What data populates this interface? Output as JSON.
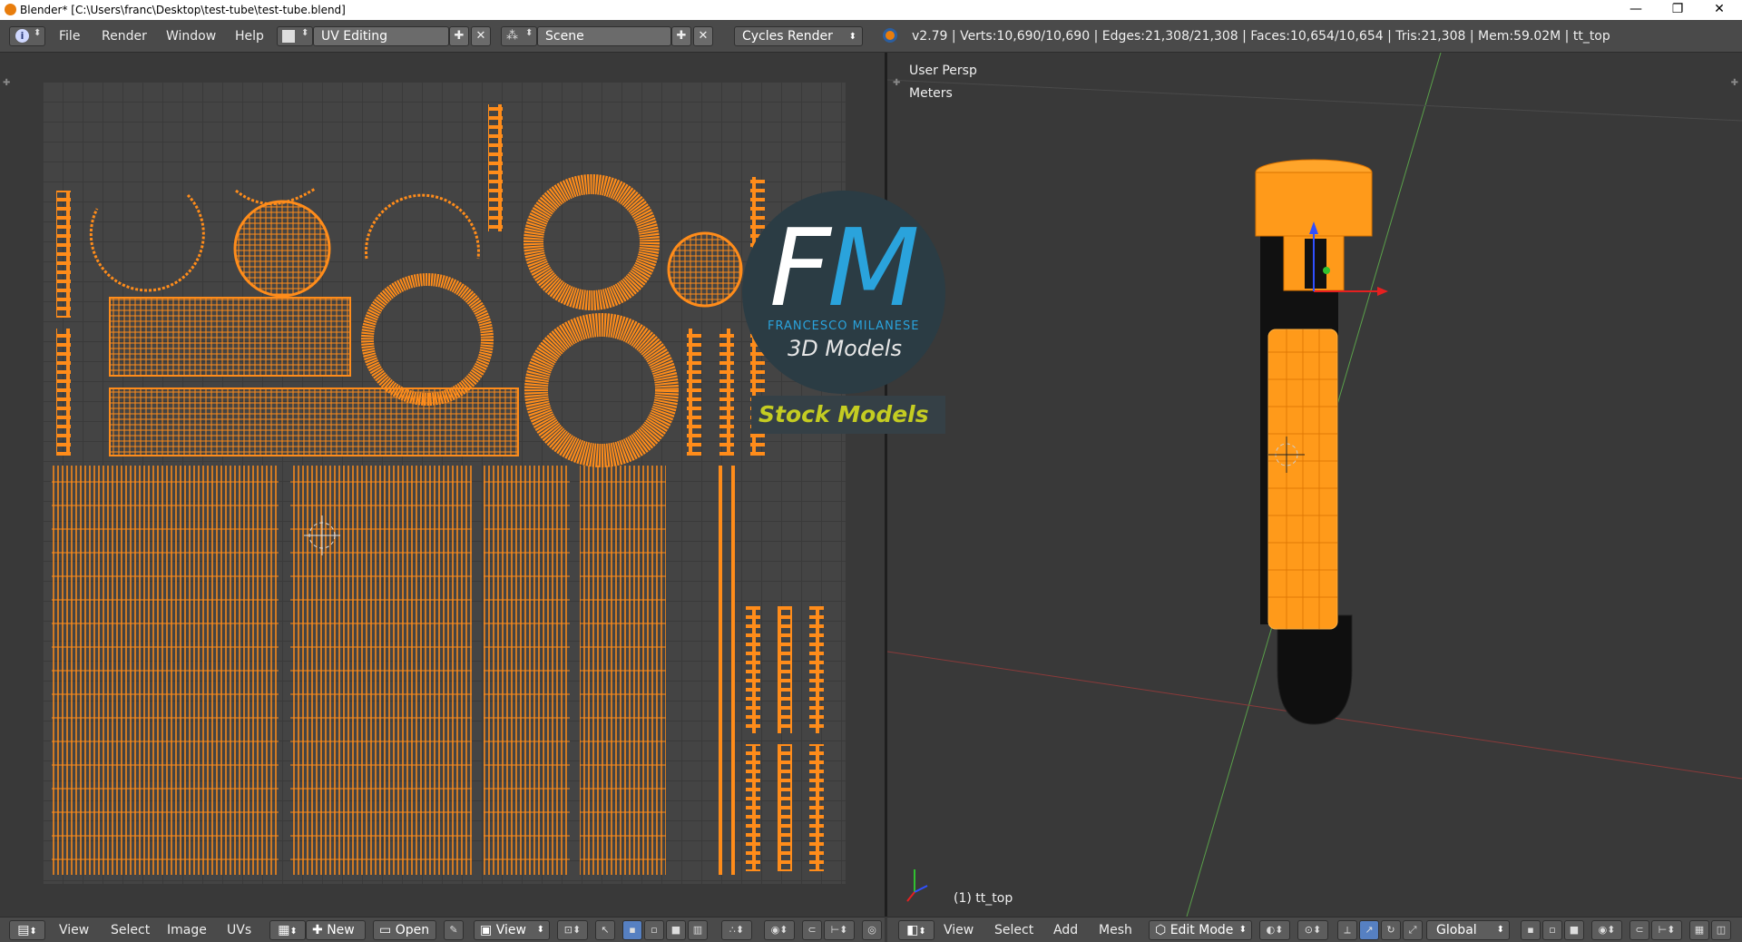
{
  "window": {
    "title": "Blender* [C:\\Users\\franc\\Desktop\\test-tube\\test-tube.blend]",
    "controls": {
      "minimize": "—",
      "restore": "❐",
      "close": "✕"
    }
  },
  "info_header": {
    "menus": [
      "File",
      "Render",
      "Window",
      "Help"
    ],
    "screen_layout": "UV Editing",
    "scene": "Scene",
    "render_engine": "Cycles Render",
    "stats": "v2.79 | Verts:10,690/10,690 | Edges:21,308/21,308 | Faces:10,654/10,654 | Tris:21,308 | Mem:59.02M | tt_top"
  },
  "uv_editor": {
    "menus": [
      "View",
      "Select",
      "Image",
      "UVs"
    ],
    "new_label": "New",
    "open_label": "Open",
    "view_label": "View"
  },
  "viewport": {
    "perspective_label": "User Persp",
    "units_label": "Meters",
    "object_label": "(1) tt_top",
    "menus": [
      "View",
      "Select",
      "Add",
      "Mesh"
    ],
    "mode": "Edit Mode",
    "orientation": "Global"
  },
  "watermark": {
    "logo_f": "F",
    "logo_m": "M",
    "brand_name": "FRANCESCO MILANESE",
    "tagline": "3D Models",
    "banner": "Stock Models"
  },
  "colors": {
    "accent_orange": "#ff8c1a",
    "logo_blue": "#2aa3dc",
    "banner_yellow": "#c4cc22",
    "background": "#393939"
  }
}
